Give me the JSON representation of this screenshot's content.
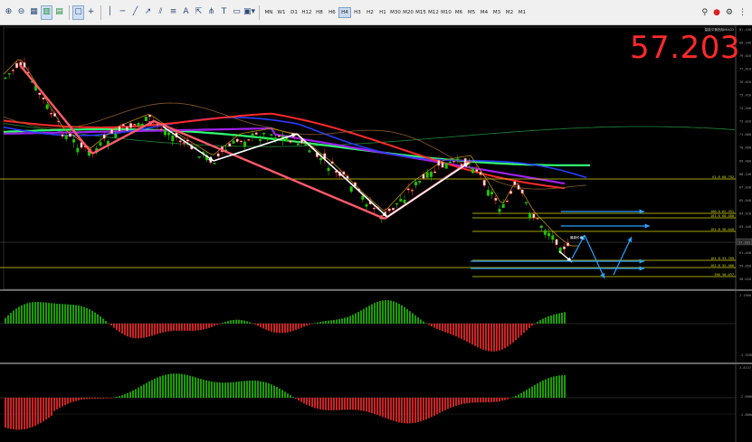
{
  "toolbar": {
    "timeframes": [
      "MN",
      "W1",
      "D1",
      "H12",
      "H8",
      "H6",
      "H4",
      "H3",
      "H2",
      "H1",
      "M30",
      "M20",
      "M15",
      "M12",
      "M10",
      "M6",
      "M5",
      "M4",
      "M3",
      "M2",
      "M1"
    ],
    "active_timeframe": "H4",
    "tool_icons": [
      "zoom-in-icon",
      "zoom-out-icon",
      "grid-icon",
      "bar-chart-icon",
      "period-separator-icon",
      "cursor-icon",
      "crosshair-icon",
      "vertical-line-icon",
      "horizontal-line-icon",
      "trend-line-icon",
      "ray-icon",
      "channel-icon",
      "fibonacci-icon",
      "text-icon",
      "arrow-icon",
      "fan-icon",
      "rectangle-icon",
      "shapes-icon"
    ],
    "right_icons": [
      "search-icon",
      "alert-icon",
      "settings-icon",
      "dots-icon"
    ]
  },
  "price_readout": "57.203",
  "indicator_header": "量能平衡指标MACD",
  "price_axis": [
    "81.430",
    "80.240",
    "79.020",
    "77.810",
    "76.620",
    "75.420",
    "74.200",
    "73.020",
    "71.800",
    "70.600",
    "69.400",
    "68.240",
    "67.030",
    "65.840",
    "64.620",
    "63.440",
    "62.240",
    "61.040",
    "59.850",
    "58.620"
  ],
  "fib_levels": [
    {
      "label": "61.8",
      "value": "68.792",
      "color": "#d8d800"
    },
    {
      "label": "100.0",
      "value": "62.351",
      "color": "#d8d800"
    },
    {
      "label": "161.8",
      "value": "60.480",
      "color": "#d8d800"
    },
    {
      "label": "161.8",
      "value": "58.040",
      "color": "#d8d800"
    },
    {
      "label": "161.8",
      "value": "53.709",
      "color": "#d8d800"
    },
    {
      "label": "161.8",
      "value": "52.400",
      "color": "#d8d800"
    },
    {
      "label": "200",
      "value": "50.037",
      "color": "#d8d800"
    }
  ],
  "current_price_tag": "57.203",
  "annotation": "最新价格",
  "osc1_axis": [
    "2.1900",
    "-2.9200"
  ],
  "osc2_axis": [
    "3.8137",
    "-2.6000",
    "-2.8000"
  ],
  "colors": {
    "bull": "#22c400",
    "bear": "#ff2a2a",
    "ma_fast": "#ff2a2a",
    "ma_blue": "#2a3cff",
    "ma_purple": "#a020f0",
    "ma_green": "#30ff70",
    "fib": "#d8d800",
    "arrow_pink": "#ff5a6a",
    "arrow_white": "#ffffff",
    "arrow_blue": "#2aa0ff"
  }
}
